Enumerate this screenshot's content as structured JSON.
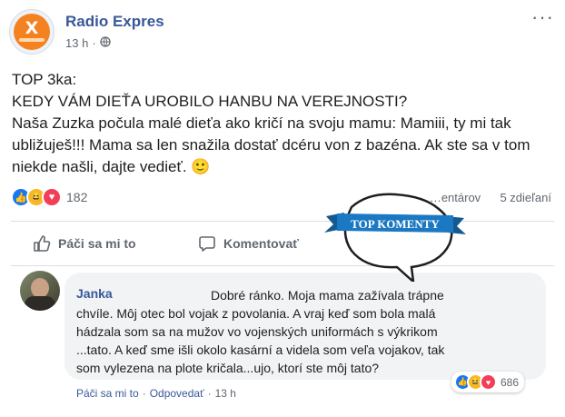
{
  "post": {
    "page_name": "Radio Expres",
    "time": "13 h",
    "separator": "·",
    "text_lines": [
      "TOP 3ka:",
      "KEDY VÁM DIEŤA UROBILO HANBU NA VEREJNOSTI?",
      "Naša Zuzka počula malé dieťa ako kričí na svoju mamu: Mamiii, ty mi tak",
      "ubližuješ!!! Mama sa len snažila dostať dcéru von z bazéna. Ak ste sa v tom",
      "niekde našli, dajte vedieť. 🙂"
    ],
    "reaction_count": "182",
    "comments_count": "…entárov",
    "shares_count": "5 zdieľaní",
    "more_icon": "more-dots-icon",
    "privacy_icon": "globe-icon"
  },
  "actions": {
    "like_label": "Páči sa mi to",
    "comment_label": "Komentovať"
  },
  "badge": {
    "text": "TOP KOMENTY",
    "color": "#1b78c2"
  },
  "comment": {
    "author": "Janka",
    "lines": [
      "Dobré ránko. Moja mama zažívala trápne",
      "chvíle. Môj otec bol vojak z povolania. A vraj keď som bola malá",
      "hádzala som sa na mužov vo vojenských uniformách s výkrikom",
      "...tato. A keď sme išli okolo kasární a videla som veľa vojakov, tak",
      "som vylezena na plote kričala...ujo, ktorí ste môj tato?"
    ],
    "reaction_count": "686",
    "like_link": "Páči sa mi to",
    "reply_link": "Odpovedať",
    "time": "13 h",
    "sep": "·"
  },
  "colors": {
    "brand_link": "#385898",
    "like_blue": "#1877f2",
    "haha_yellow": "#f7b928",
    "love_red": "#f33e58"
  }
}
